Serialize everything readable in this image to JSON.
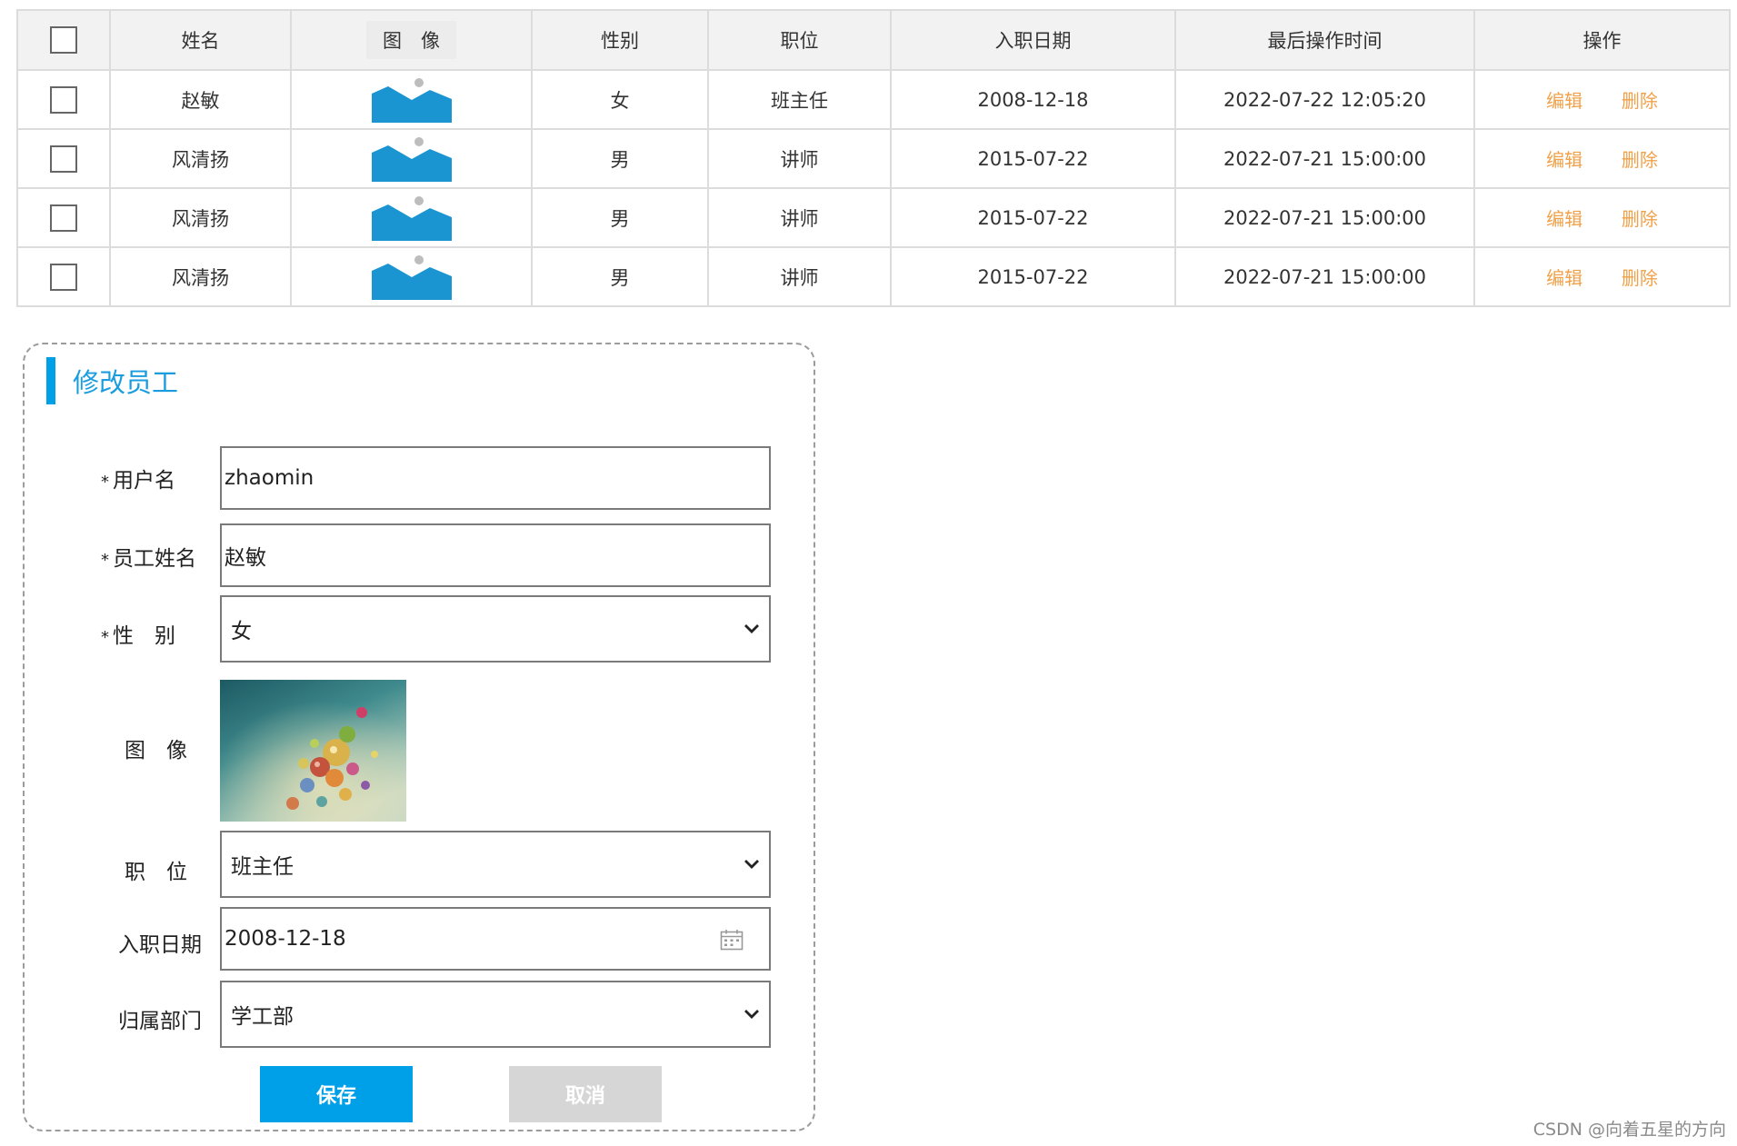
{
  "table": {
    "headers": {
      "name": "姓名",
      "image": "图　像",
      "gender": "性别",
      "position": "职位",
      "entry_date": "入职日期",
      "last_op_time": "最后操作时间",
      "actions": "操作"
    },
    "edit_label": "编辑",
    "delete_label": "删除",
    "thumb_icon": "image-placeholder-icon",
    "rows": [
      {
        "name": "赵敏",
        "gender": "女",
        "position": "班主任",
        "entry_date": "2008-12-18",
        "last_op_time": "2022-07-22 12:05:20"
      },
      {
        "name": "风清扬",
        "gender": "男",
        "position": "讲师",
        "entry_date": "2015-07-22",
        "last_op_time": "2022-07-21 15:00:00"
      },
      {
        "name": "风清扬",
        "gender": "男",
        "position": "讲师",
        "entry_date": "2015-07-22",
        "last_op_time": "2022-07-21 15:00:00"
      },
      {
        "name": "风清扬",
        "gender": "男",
        "position": "讲师",
        "entry_date": "2015-07-22",
        "last_op_time": "2022-07-21 15:00:00"
      }
    ]
  },
  "form": {
    "title": "修改员工",
    "required_mark": "*",
    "username_label": "用户名",
    "username_value": "zhaomin",
    "name_label": "员工姓名",
    "name_value": "赵敏",
    "gender_label": "性　别",
    "gender_value": "女",
    "image_label": "图　像",
    "position_label": "职　位",
    "position_value": "班主任",
    "entry_date_label": "入职日期",
    "entry_date_value": "2008-12-18",
    "dept_label": "归属部门",
    "dept_value": "学工部",
    "save_label": "保存",
    "cancel_label": "取消"
  },
  "watermark": "CSDN @向着五星的方向",
  "colors": {
    "accent": "#00a0e9",
    "link": "#f0a14a",
    "header_bg": "#f2f2f2",
    "cancel_bg": "#d6d6d6",
    "thumb": "#1a95d2"
  }
}
